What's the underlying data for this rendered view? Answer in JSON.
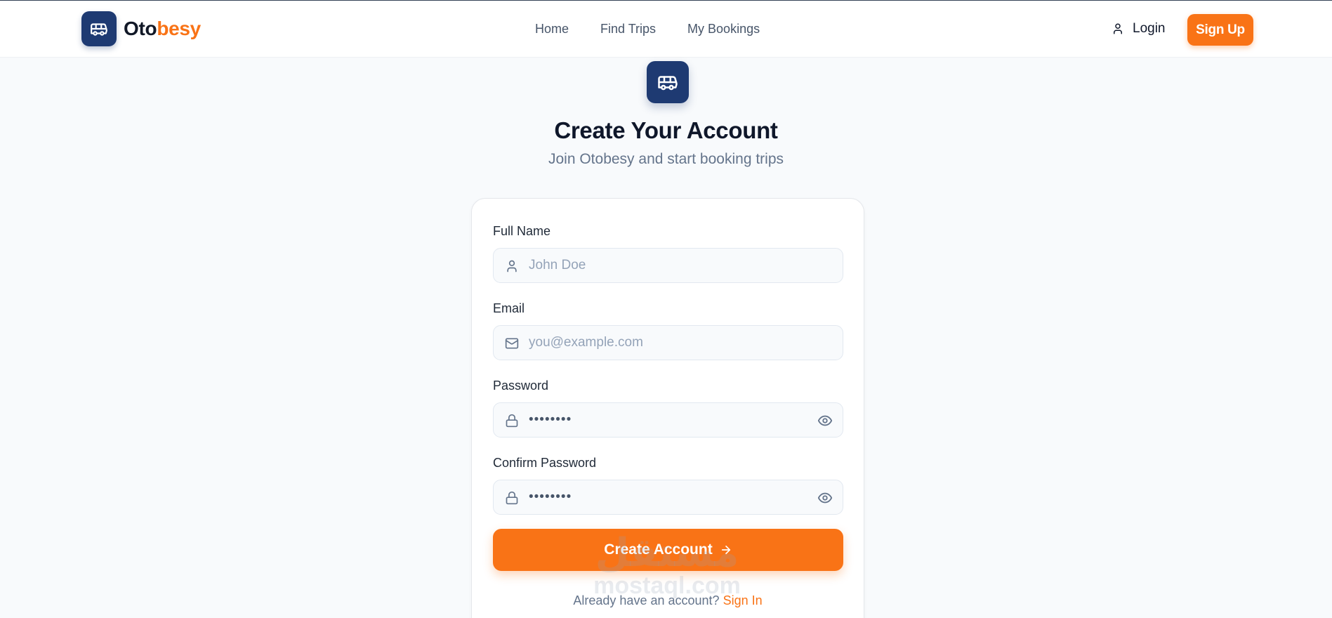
{
  "header": {
    "brand_part1": "Oto",
    "brand_part2": "besy",
    "logo_icon": "bus-icon",
    "nav": [
      {
        "label": "Home"
      },
      {
        "label": "Find Trips"
      },
      {
        "label": "My Bookings"
      }
    ],
    "login_label": "Login",
    "login_icon": "user-icon",
    "signup_label": "Sign Up"
  },
  "page": {
    "hero_icon": "bus-icon",
    "title": "Create Your Account",
    "subtitle": "Join Otobesy and start booking trips"
  },
  "form": {
    "full_name": {
      "label": "Full Name",
      "placeholder": "John Doe",
      "icon": "user-icon"
    },
    "email": {
      "label": "Email",
      "placeholder": "you@example.com",
      "icon": "mail-icon"
    },
    "password": {
      "label": "Password",
      "value_masked": "••••••••",
      "icon": "lock-icon",
      "toggle_icon": "eye-icon"
    },
    "confirm_password": {
      "label": "Confirm Password",
      "value_masked": "••••••••",
      "icon": "lock-icon",
      "toggle_icon": "eye-icon"
    },
    "submit_label": "Create Account",
    "submit_icon": "arrow-right-icon",
    "signin_prompt": "Already have an account?",
    "signin_link": "Sign In"
  },
  "watermark": {
    "line1": "مستقل",
    "line2": "mostaql.com"
  },
  "colors": {
    "primary_navy": "#1e3a72",
    "accent_orange": "#f97316",
    "background": "#f8fafc"
  }
}
